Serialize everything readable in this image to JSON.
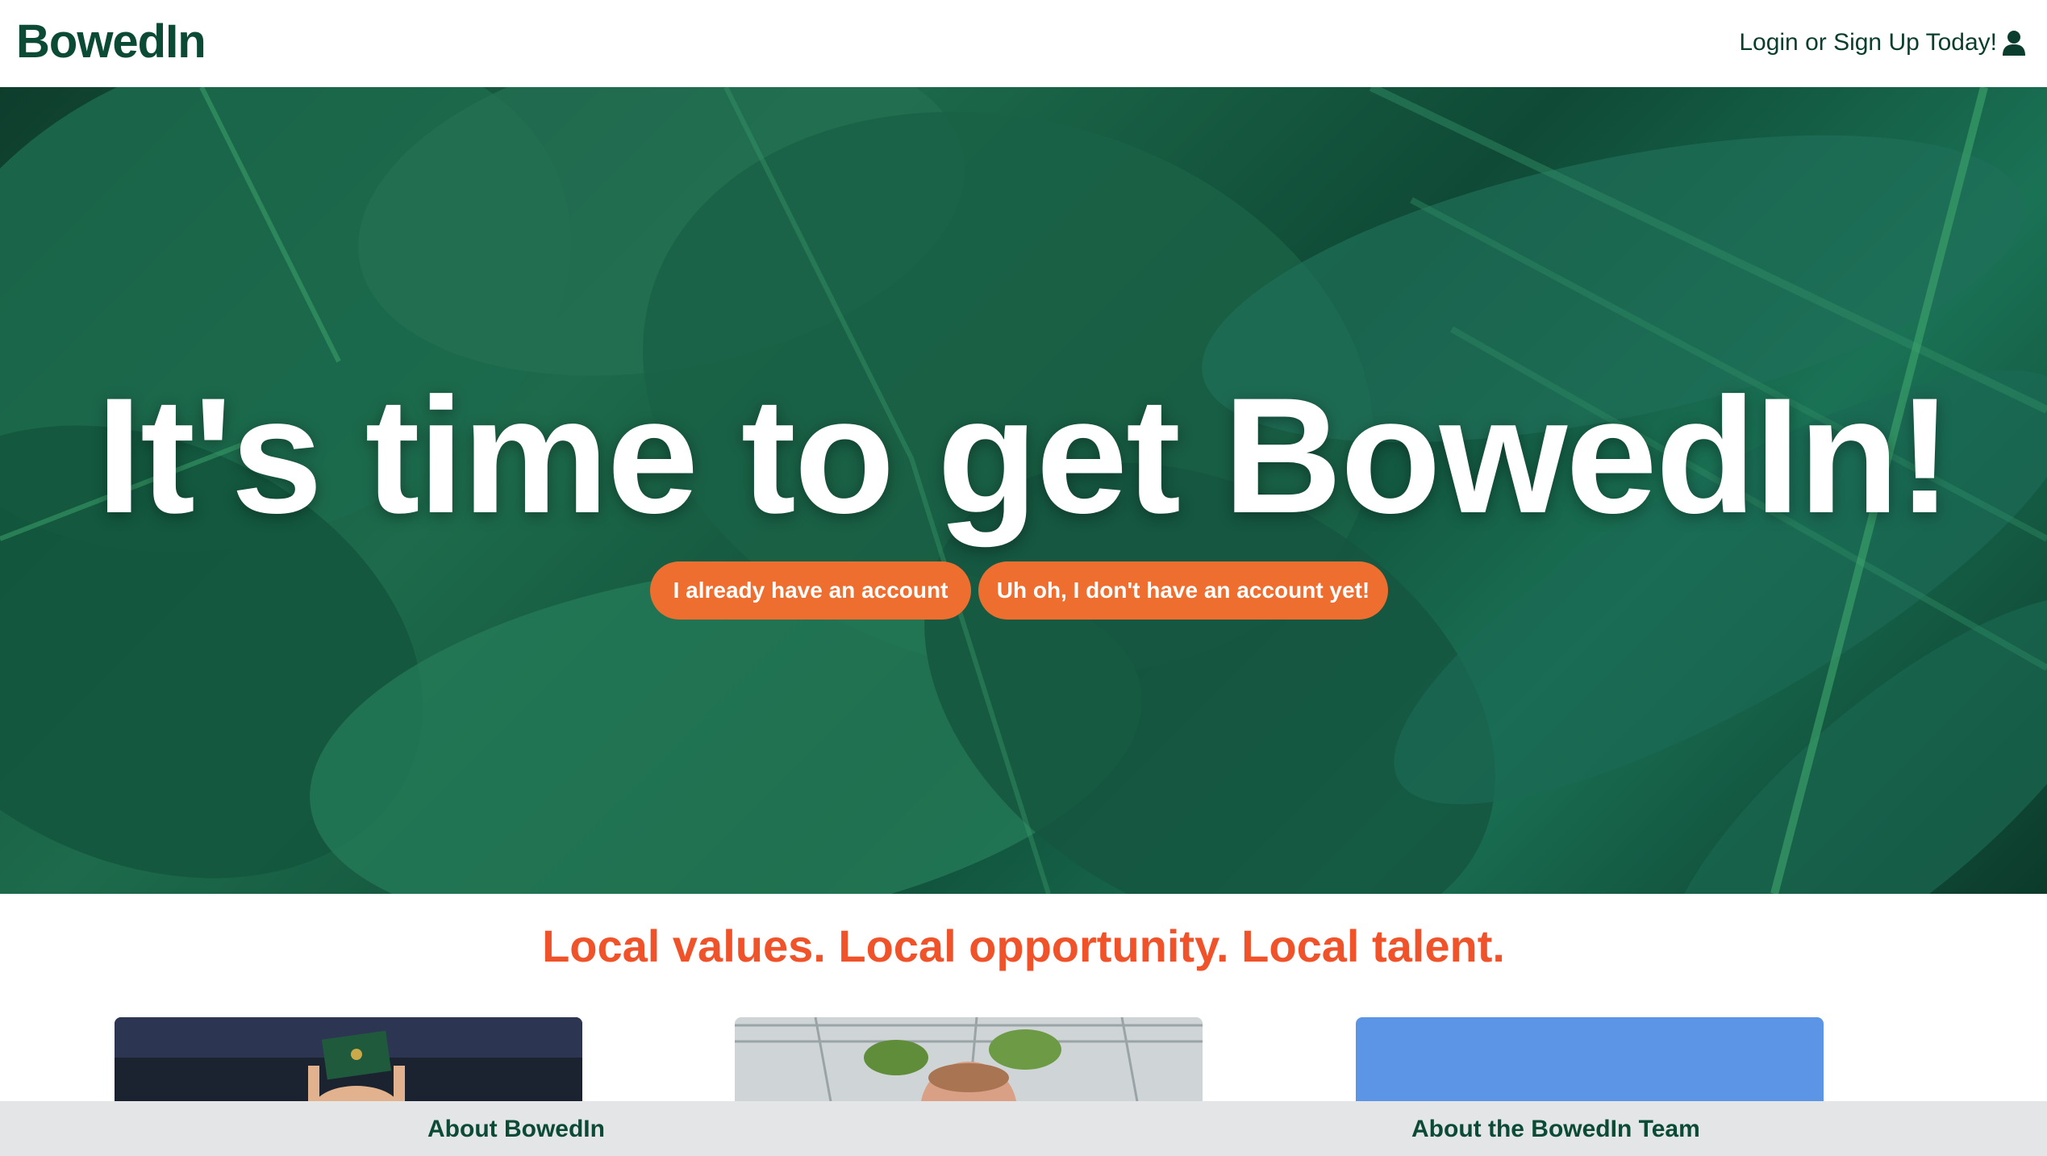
{
  "navbar": {
    "brand": "BowedIn",
    "login_link": "Login or Sign Up Today!",
    "login_icon": "user-icon"
  },
  "hero": {
    "title": "It's time to get BowedIn!",
    "buttons": {
      "login": "I already have an account",
      "signup": "Uh oh, I don't have an account yet!"
    },
    "button_color": "#ee6e30"
  },
  "tagline": "Local values. Local opportunity. Local talent.",
  "footer": {
    "about": "About BowedIn",
    "team": "About the BowedIn Team"
  },
  "colors": {
    "brand": "#0b4a34",
    "accent": "#f0532a",
    "footer_bg": "#e3e5e7"
  }
}
